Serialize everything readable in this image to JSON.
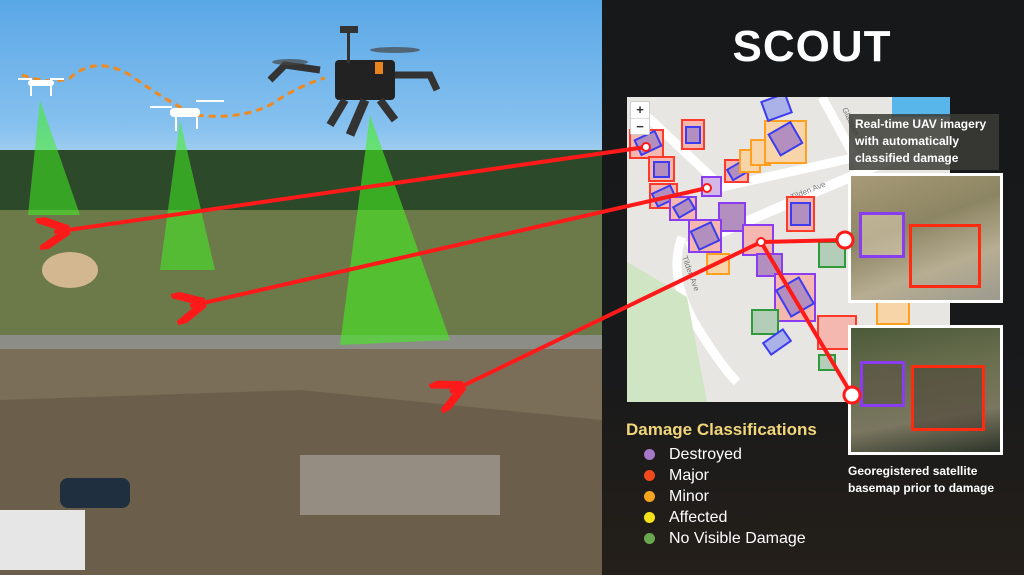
{
  "app": {
    "title": "SCOUT"
  },
  "map": {
    "zoom_in_label": "+",
    "zoom_out_label": "−",
    "street_labels": [
      "Gladden Rd",
      "Tilden Ave",
      "Tilden Ave"
    ]
  },
  "callouts": {
    "uav": "Real-time UAV imagery with automatically classified damage",
    "uav_lines": [
      "Real-time UAV imagery",
      "with automatically",
      "classified damage"
    ],
    "satellite_lines": [
      "Georegistered satellite",
      "basemap prior to damage"
    ]
  },
  "legend": {
    "title": "Damage Classifications",
    "items": [
      {
        "label": "Destroyed",
        "color": "#a678c8"
      },
      {
        "label": "Major",
        "color": "#f04a1c"
      },
      {
        "label": "Minor",
        "color": "#f5a51e"
      },
      {
        "label": "Affected",
        "color": "#f5e21a"
      },
      {
        "label": "No Visible Damage",
        "color": "#6aa84f"
      }
    ]
  },
  "colors": {
    "destroyed": "#8a3cf0",
    "major": "#ff3a2a",
    "minor": "#ffa020",
    "none": "#2e9a3a",
    "arrow": "#ff1a1a",
    "drone_beam": "#44ee22",
    "flight_path": "#f08a1e"
  }
}
